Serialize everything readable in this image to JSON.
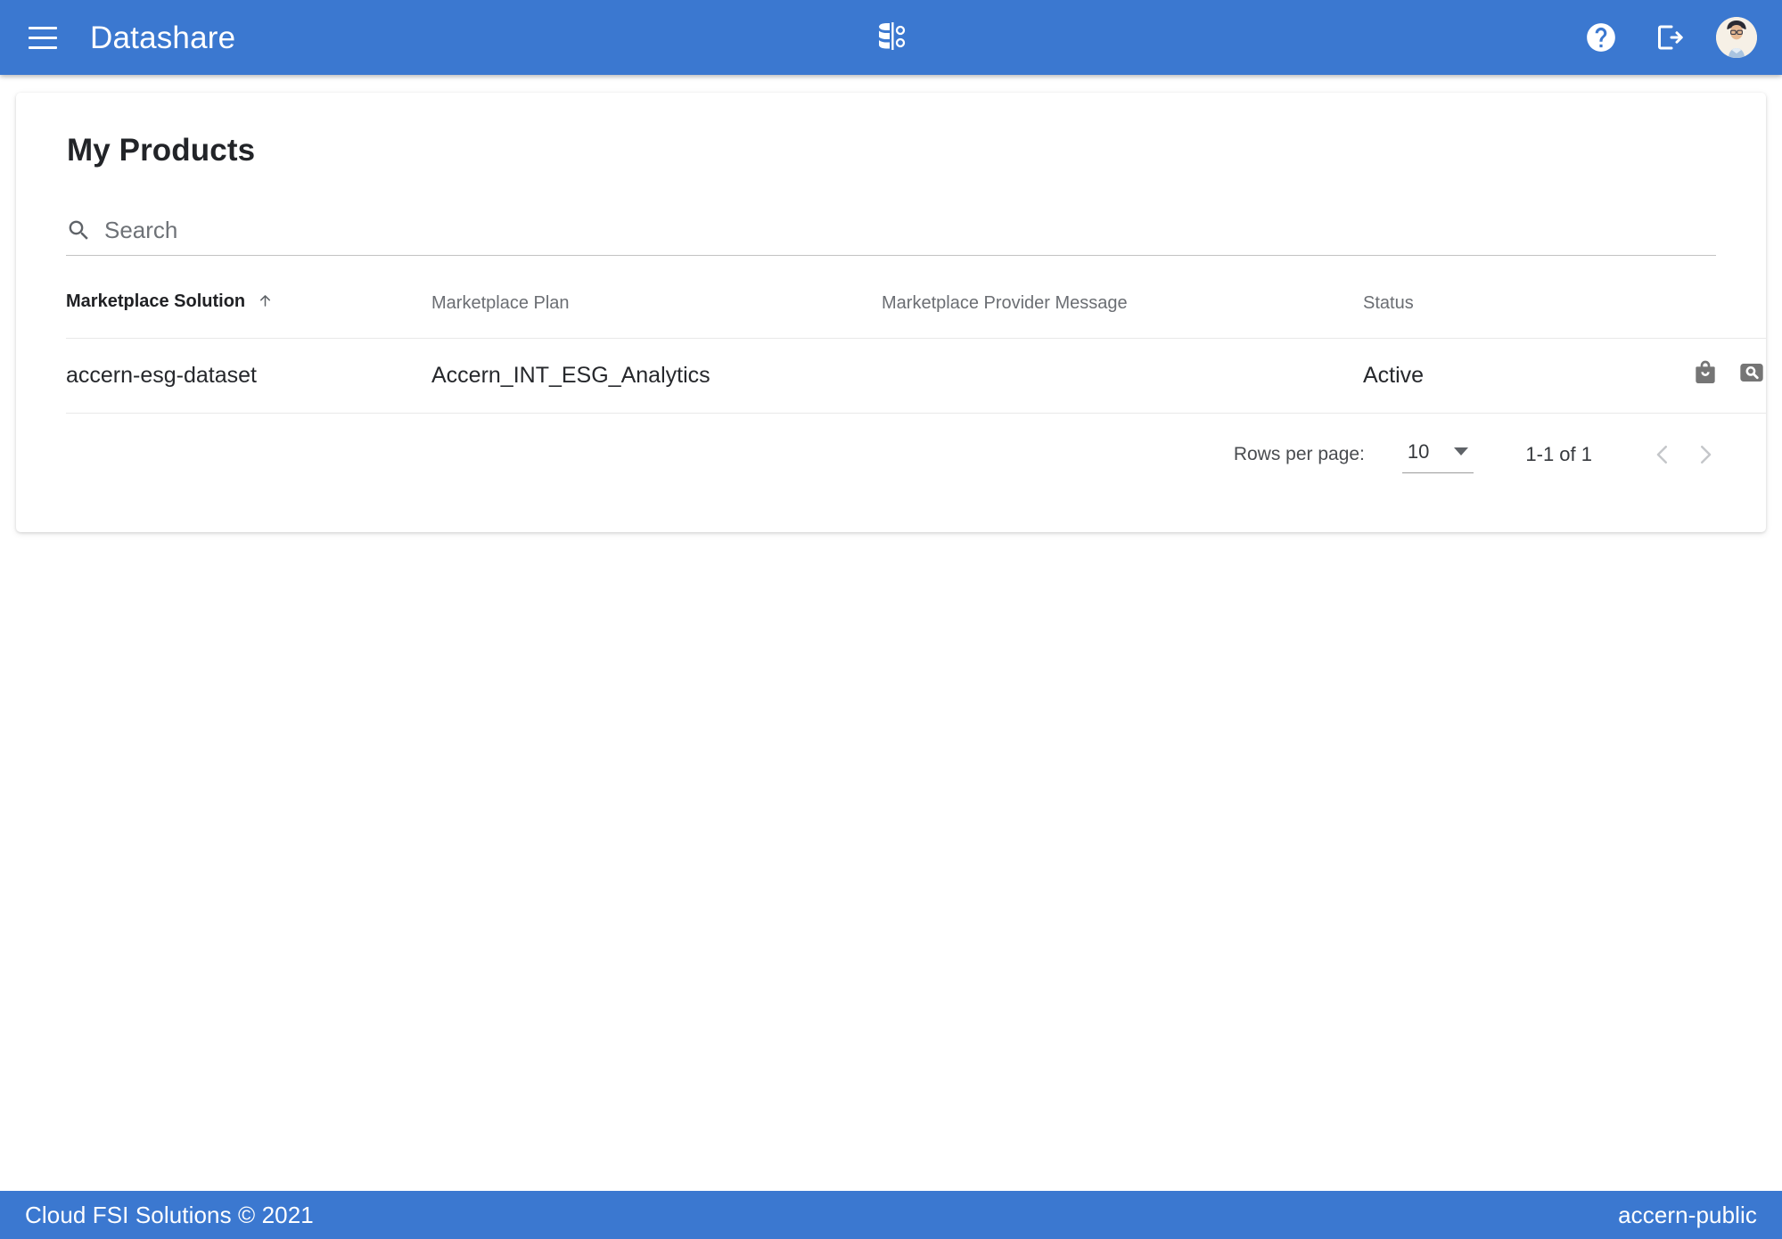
{
  "appbar": {
    "menu_icon": "hamburger-menu-icon",
    "title": "Datashare",
    "logo_icon": "datashare-database-logo",
    "help_icon": "help-circle-icon",
    "logout_icon": "logout-icon",
    "avatar_icon": "user-avatar"
  },
  "main": {
    "page_title": "My Products",
    "search": {
      "icon": "search-icon",
      "placeholder": "Search",
      "value": ""
    },
    "table": {
      "columns": [
        {
          "key": "solution",
          "label": "Marketplace Solution",
          "sorted": true,
          "sort_direction": "asc"
        },
        {
          "key": "plan",
          "label": "Marketplace Plan",
          "sorted": false
        },
        {
          "key": "message",
          "label": "Marketplace Provider Message",
          "sorted": false
        },
        {
          "key": "status",
          "label": "Status",
          "sorted": false
        }
      ],
      "rows": [
        {
          "solution": "accern-esg-dataset",
          "plan": "Accern_INT_ESG_Analytics",
          "message": "",
          "status": "Active",
          "actions": [
            {
              "name": "marketplace-bag-icon"
            },
            {
              "name": "view-details-search-icon"
            }
          ]
        }
      ]
    },
    "paginator": {
      "rows_per_page_label": "Rows per page:",
      "rows_per_page_value": "10",
      "range_label": "1-1 of 1",
      "prev_icon": "chevron-left-icon",
      "next_icon": "chevron-right-icon",
      "prev_disabled": true,
      "next_disabled": true
    }
  },
  "footer": {
    "copyright": "Cloud FSI Solutions © 2021",
    "project": "accern-public"
  },
  "colors": {
    "brand_blue": "#3b78d0",
    "text_primary": "#26282c",
    "text_secondary": "#6b6e73",
    "icon_grey": "#757575",
    "divider": "#e8e8e8"
  }
}
